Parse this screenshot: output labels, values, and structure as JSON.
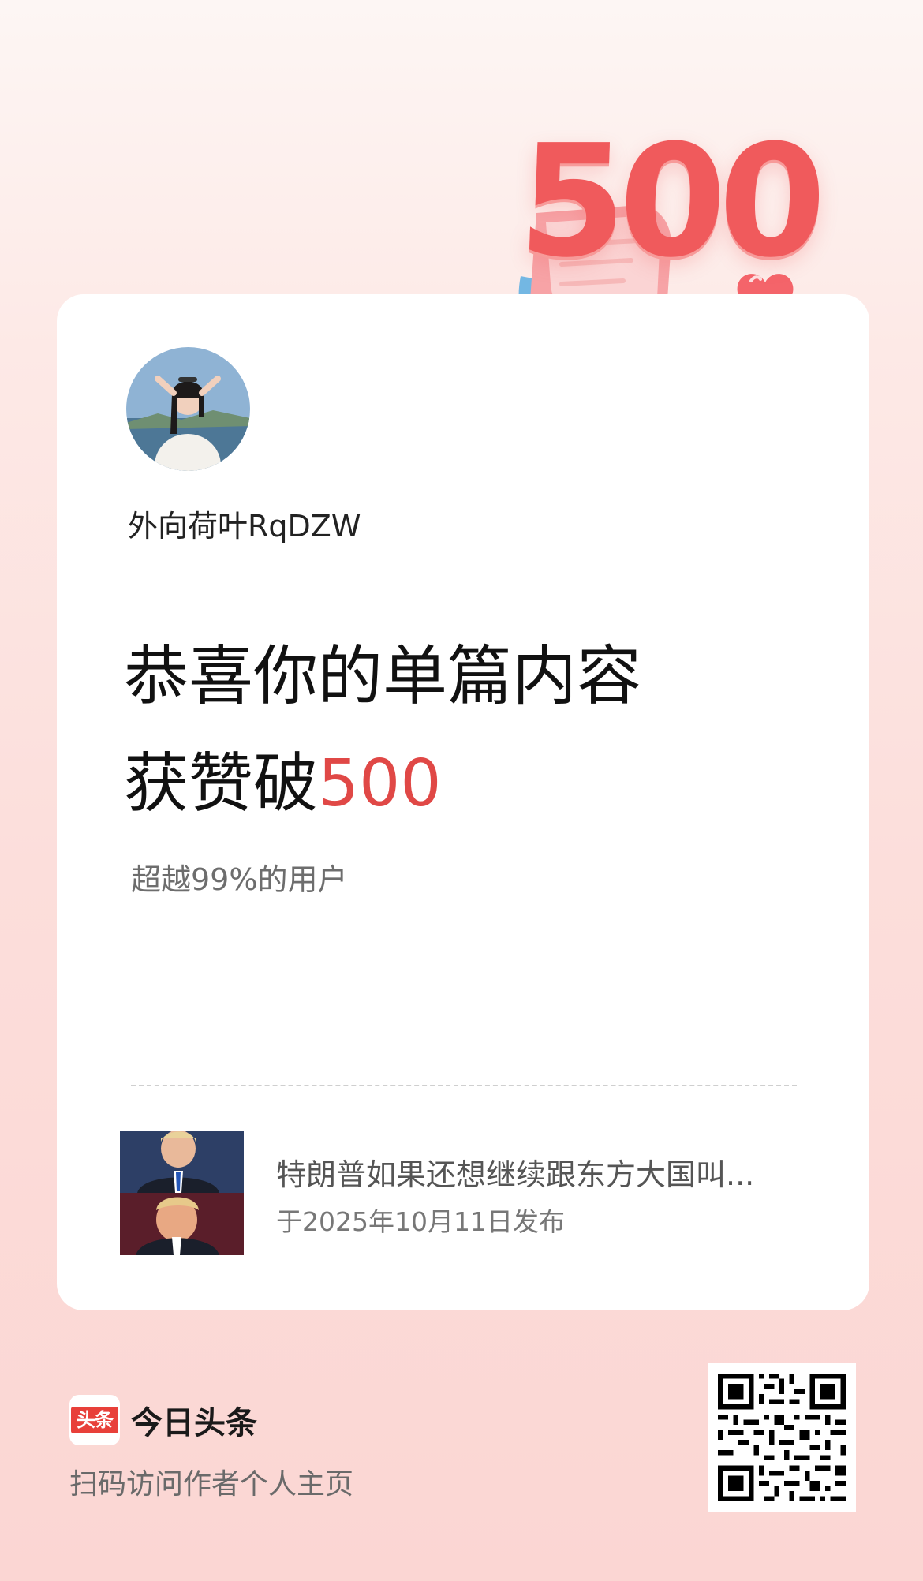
{
  "milestone": {
    "badge_number": "500",
    "accent_color": "#e04846"
  },
  "author": {
    "name": "外向荷叶RqDZW",
    "avatar_icon": "author-avatar"
  },
  "headline": {
    "line1": "恭喜你的单篇内容",
    "line2_prefix": "获赞破",
    "line2_number": "500"
  },
  "subline": "超越99%的用户",
  "post": {
    "thumbnail_icon": "article-thumbnail",
    "title": "特朗普如果还想继续跟东方大国叫...",
    "date": "于2025年10月11日发布"
  },
  "footer": {
    "logo_text": "头条",
    "brand_name": "今日头条",
    "scan_tip": "扫码访问作者个人主页",
    "qr_icon": "qr-code"
  }
}
